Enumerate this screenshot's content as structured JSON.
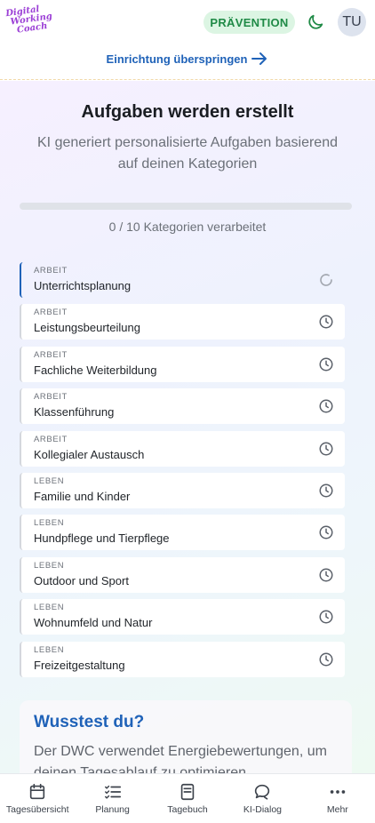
{
  "header": {
    "logo_lines": [
      "Digital",
      "Working",
      "Coach"
    ],
    "badge": "PRÄVENTION",
    "avatar_initials": "TU",
    "skip_link": "Einrichtung überspringen"
  },
  "main": {
    "title": "Aufgaben werden erstellt",
    "subtitle": "KI generiert personalisierte Aufgaben basierend auf deinen Kategorien",
    "progress": {
      "processed": 0,
      "total": 10,
      "text": "0 / 10 Kategorien verarbeitet"
    },
    "categories": [
      {
        "group": "ARBEIT",
        "name": "Unterrichtsplanung",
        "status": "loading"
      },
      {
        "group": "ARBEIT",
        "name": "Leistungsbeurteilung",
        "status": "pending"
      },
      {
        "group": "ARBEIT",
        "name": "Fachliche Weiterbildung",
        "status": "pending"
      },
      {
        "group": "ARBEIT",
        "name": "Klassenführung",
        "status": "pending"
      },
      {
        "group": "ARBEIT",
        "name": "Kollegialer Austausch",
        "status": "pending"
      },
      {
        "group": "LEBEN",
        "name": "Familie und Kinder",
        "status": "pending"
      },
      {
        "group": "LEBEN",
        "name": "Hundpflege und Tierpflege",
        "status": "pending"
      },
      {
        "group": "LEBEN",
        "name": "Outdoor und Sport",
        "status": "pending"
      },
      {
        "group": "LEBEN",
        "name": "Wohnumfeld und Natur",
        "status": "pending"
      },
      {
        "group": "LEBEN",
        "name": "Freizeitgestaltung",
        "status": "pending"
      }
    ],
    "tip": {
      "title": "Wusstest du?",
      "text": "Der DWC verwendet Energiebewertungen, um deinen Tagesablauf zu optimieren."
    }
  },
  "nav": [
    {
      "label": "Tagesübersicht",
      "icon": "calendar-icon"
    },
    {
      "label": "Planung",
      "icon": "checklist-icon"
    },
    {
      "label": "Tagebuch",
      "icon": "book-icon"
    },
    {
      "label": "KI-Dialog",
      "icon": "chat-icon"
    },
    {
      "label": "Mehr",
      "icon": "more-icon"
    }
  ],
  "colors": {
    "accent": "#1f62b8",
    "badge_bg": "#dcf5e3",
    "badge_text": "#1f8a46",
    "logo": "#9b3fd6"
  }
}
